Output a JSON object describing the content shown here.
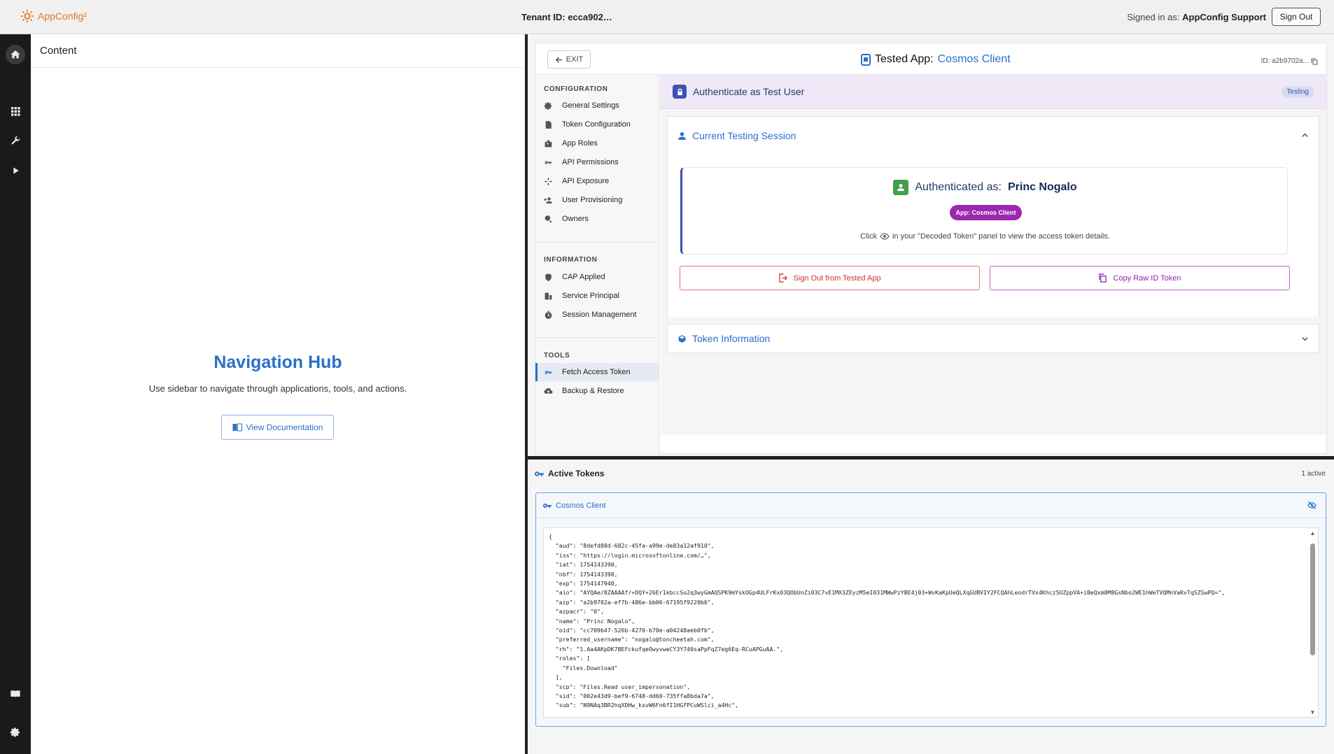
{
  "topbar": {
    "logo_text": "AppConfig²",
    "tenant_label": "Tenant ID: ecca902…",
    "signed_in_prefix": "Signed in as:",
    "signed_in_user": "AppConfig Support",
    "sign_out_label": "Sign Out"
  },
  "rail": {
    "items": [
      "home-icon",
      "apps-grid-icon",
      "wrench-icon",
      "play-icon",
      "book-icon",
      "gear-icon"
    ]
  },
  "content": {
    "header": "Content",
    "hub_title": "Navigation Hub",
    "hub_subtitle": "Use sidebar to navigate through applications, tools, and actions.",
    "doc_button": "View Documentation"
  },
  "app_panel": {
    "exit_label": "EXIT",
    "tested_prefix": "Tested App:",
    "tested_app": "Cosmos Client",
    "app_id": "ID: a2b9702a...",
    "nav": {
      "sections": [
        {
          "title": "CONFIGURATION",
          "items": [
            "General Settings",
            "Token Configuration",
            "App Roles",
            "API Permissions",
            "API Exposure",
            "User Provisioning",
            "Owners"
          ]
        },
        {
          "title": "INFORMATION",
          "items": [
            "CAP Applied",
            "Service Principal",
            "Session Management"
          ]
        },
        {
          "title": "TOOLS",
          "items": [
            "Fetch Access Token",
            "Backup & Restore"
          ]
        }
      ],
      "active": "Fetch Access Token"
    },
    "auth": {
      "header": "Authenticate as Test User",
      "badge": "Testing",
      "session_title": "Current Testing Session",
      "authenticated_prefix": "Authenticated as:",
      "authenticated_user": "Princ Nogalo",
      "app_chip": "App: Cosmos Client",
      "hint_before": "Click",
      "hint_after": "in your \"Decoded Token\" panel to view the access token details.",
      "sign_out_button": "Sign Out from Tested App",
      "copy_button": "Copy Raw ID Token",
      "token_info_title": "Token Information"
    }
  },
  "tokens": {
    "title": "Active Tokens",
    "count": "1 active",
    "card_title": "Cosmos Client",
    "json_text": "{\n  \"aud\": \"8defd88d-682c-45fa-a99e-de83a12af910\",\n  \"iss\": \"https://login.microsoftonline.com/…\",\n  \"iat\": 1754143390,\n  \"nbf\": 1754143390,\n  \"exp\": 1754147940,\n  \"aio\": \"AYQAe/8ZAAAAf/+DQY+26Er1kbccSo2q3wyGmAQSPK9mYskOGp4ULFrKx03QObUnZi03C7vE1MX3ZEyzM5eI031MWwPzYBE4j03+WvKaKpUeQLXqGUBVIY2FCQAhLeodrTVx4Khcz5UZppVA+iBeQxm8M8GsNbo2WE1hWeTVQMnVaRvTqSZSwPQ=\",\n  \"azp\": \"a2b9702a-ef7b-486e-bb06-67195f9220b6\",\n  \"azpacr\": \"0\",\n  \"name\": \"Princ Nogalo\",\n  \"oid\": \"cc709b47-526b-4270-b70e-a04248aeb0fb\",\n  \"preferred_username\": \"nogalo@toncheetah.com\",\n  \"rh\": \"1.Aa4AKpDK7BEFckufqeOwyvweCY3Y740saPpFqZ7eg6Eq-RCuAPGuAA.\",\n  \"roles\": [\n    \"Files.Download\"\n  ],\n  \"scp\": \"Files.Read user_impersonation\",\n  \"sid\": \"002e43d9-bef9-6748-dd60-735ffa8bda7a\",\n  \"sub\": \"N9NAq3BR2hqXDHw_kxvW6Fn6fI1HGfPCuWSlci_a4Hc\","
  },
  "colors": {
    "accent": "#2a6fc9",
    "rail": "#1a1a1a",
    "logo": "#e07a1f",
    "chip": "#9c27b0",
    "success": "#43a047",
    "danger": "#d32f2f"
  }
}
